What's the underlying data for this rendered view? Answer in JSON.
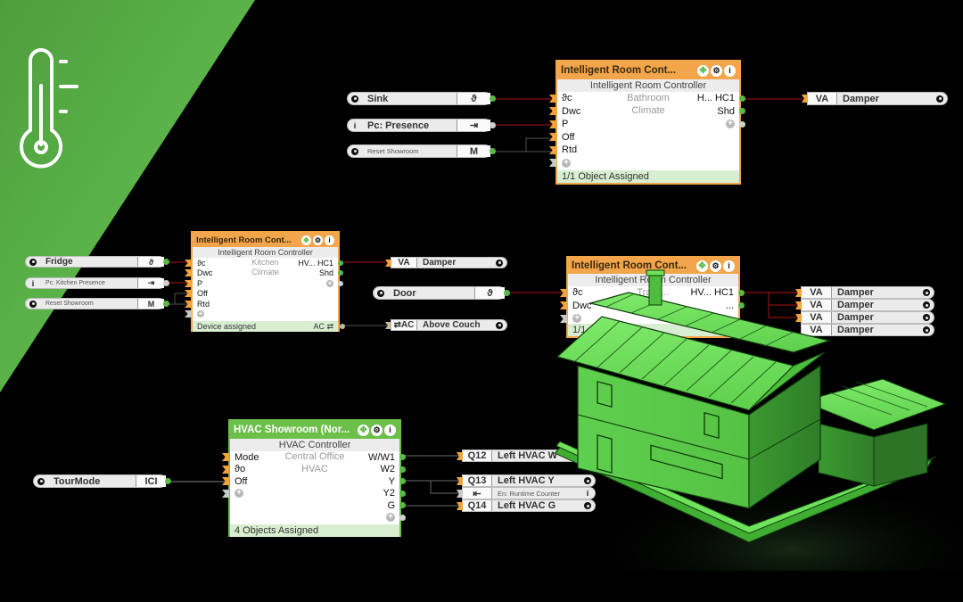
{
  "banner": {
    "icon": "thermometer-icon",
    "accent_color": "#5cb046"
  },
  "controllers": [
    {
      "id": "bathroom",
      "title": "Intelligent Room Cont...",
      "subtitle": "Intelligent Room Controller",
      "inputs": [
        "ϑc",
        "Dwc",
        "P",
        "Off",
        "Rtd"
      ],
      "location_line1": "Bathroom",
      "location_line2": "Climate",
      "outputs": [
        "H... HC1",
        "Shd"
      ],
      "footer": "1/1 Object Assigned",
      "footer_right": ""
    },
    {
      "id": "kitchen",
      "title": "Intelligent Room Cont...",
      "subtitle": "Intelligent Room Controller",
      "inputs": [
        "ϑc",
        "Dwc",
        "P",
        "Off",
        "Rtd"
      ],
      "location_line1": "Kitchen",
      "location_line2": "Climate",
      "outputs": [
        "HV... HC1",
        "Shd"
      ],
      "footer": "Device assigned",
      "footer_right": "AC ⇄"
    },
    {
      "id": "training",
      "title": "Intelligent Room Cont...",
      "subtitle": "Intelligent Room Controller",
      "inputs": [
        "ϑc",
        "Dwc"
      ],
      "location_line1": "Traini...",
      "location_line2": "",
      "outputs": [
        "HV... HC1",
        "..."
      ],
      "footer": "1/1 Ob...",
      "footer_right": ""
    },
    {
      "id": "hvac",
      "title": "HVAC Showroom (Nor...",
      "subtitle": "HVAC Controller",
      "inputs": [
        "Mode",
        "ϑo",
        "Off"
      ],
      "location_line1": "Central Office",
      "location_line2": "HVAC",
      "outputs": [
        "W/W1",
        "W2",
        "Y",
        "Y2",
        "G"
      ],
      "footer": "4 Objects Assigned",
      "footer_right": ""
    }
  ],
  "header_buttons": {
    "move": "✥",
    "settings": "⚙",
    "info": "i"
  },
  "input_blocks": [
    {
      "id": "sink",
      "icon": "gear-icon",
      "name": "Sink",
      "tag": "ϑ"
    },
    {
      "id": "pc-presence",
      "icon": "info-icon",
      "name": "Pc: Presence",
      "tag": "⇥"
    },
    {
      "id": "reset-showroom-1",
      "icon": "gear-icon",
      "name": "Reset Showroom",
      "tag": "M"
    },
    {
      "id": "fridge",
      "icon": "gear-icon",
      "name": "Fridge",
      "tag": "ϑ"
    },
    {
      "id": "pc-kitchen-presence",
      "icon": "info-icon",
      "name": "Pc: Kitchen Presence",
      "tag": "⇥"
    },
    {
      "id": "reset-showroom-2",
      "icon": "gear-icon",
      "name": "Reset Showroom",
      "tag": "M"
    },
    {
      "id": "door",
      "icon": "gear-icon",
      "name": "Door",
      "tag": "ϑ"
    },
    {
      "id": "tourmode",
      "icon": "gear-icon",
      "name": "TourMode",
      "tag": "ICI"
    }
  ],
  "output_blocks": [
    {
      "id": "damper-1",
      "tag": "VA",
      "name": "Damper",
      "icon": "gear-icon"
    },
    {
      "id": "damper-2",
      "tag": "VA",
      "name": "Damper",
      "icon": "gear-icon"
    },
    {
      "id": "above-couch",
      "tag": "⇄AC",
      "name": "Above Couch",
      "icon": "gear-icon"
    },
    {
      "id": "damper-3",
      "tag": "VA",
      "name": "Damper",
      "icon": "gear-icon"
    },
    {
      "id": "damper-4",
      "tag": "VA",
      "name": "Damper",
      "icon": "gear-icon"
    },
    {
      "id": "damper-5",
      "tag": "VA",
      "name": "Damper",
      "icon": "gear-icon"
    },
    {
      "id": "damper-6",
      "tag": "VA",
      "name": "Damper",
      "icon": "gear-icon"
    },
    {
      "id": "left-hvac-w",
      "tag": "Q12",
      "name": "Left HVAC W",
      "icon": "gear-icon"
    },
    {
      "id": "left-hvac-y",
      "tag": "Q13",
      "name": "Left HVAC Y",
      "icon": "gear-icon"
    },
    {
      "id": "runtime-counter",
      "tag": "⇤",
      "name": "En: Runtime Counter",
      "icon": "info-icon"
    },
    {
      "id": "left-hvac-g",
      "tag": "Q14",
      "name": "Left HVAC G",
      "icon": "gear-icon"
    }
  ],
  "illustration": {
    "subject": "green 3D house model"
  }
}
